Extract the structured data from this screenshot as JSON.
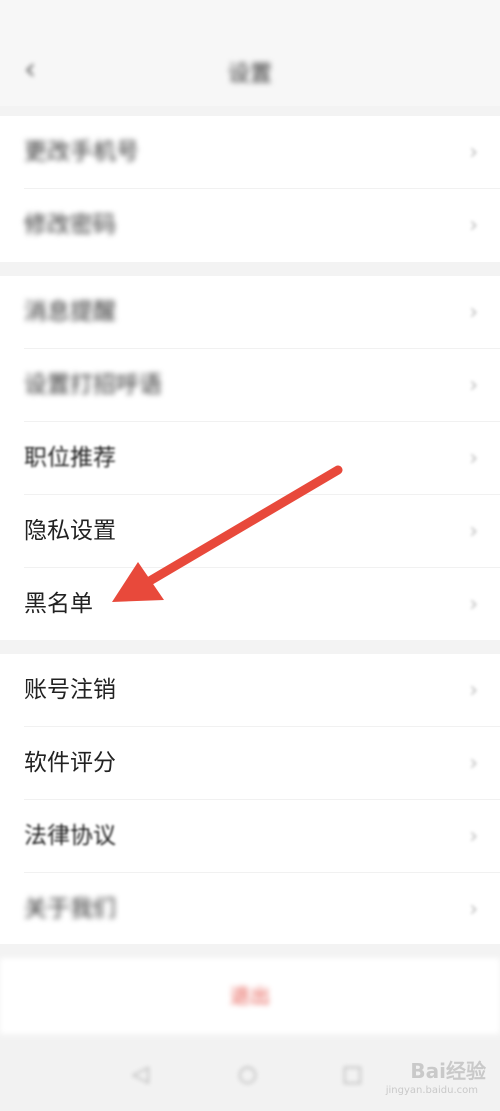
{
  "status_bar": {
    "carrier": "",
    "icons": ""
  },
  "nav": {
    "back_icon": "back-icon",
    "title": "设置"
  },
  "group1": [
    {
      "label": "更改手机号",
      "value": "",
      "value_color": "#e5584f"
    },
    {
      "label": "修改密码",
      "value": ""
    }
  ],
  "group2": [
    {
      "label": "消息提醒",
      "value": ""
    },
    {
      "label": "设置打招呼语",
      "value": ""
    },
    {
      "label": "职位推荐",
      "value": ""
    },
    {
      "label": "隐私设置",
      "value": ""
    },
    {
      "label": "黑名单",
      "value": ""
    }
  ],
  "group3": [
    {
      "label": "账号注销",
      "value": ""
    },
    {
      "label": "软件评分",
      "value": ""
    },
    {
      "label": "法律协议",
      "value": ""
    },
    {
      "label": "关于我们",
      "value": ""
    }
  ],
  "logout": {
    "label": "退出"
  },
  "watermark": {
    "text": "Bai经验",
    "sub": "jingyan.baidu.com"
  },
  "colors": {
    "accent": "#e5584f",
    "annotation_arrow": "#e8493b",
    "background": "#f3f3f3"
  },
  "icons": {
    "chevron": "chevron-right-icon",
    "back": "back-icon",
    "arrow": "annotation-arrow"
  }
}
